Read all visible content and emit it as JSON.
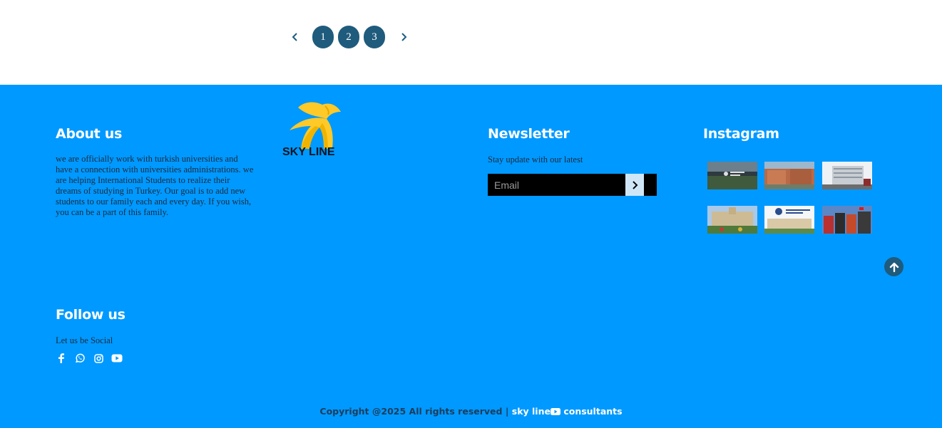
{
  "pagination": {
    "prev_icon": "chevron-left-icon",
    "next_icon": "chevron-right-icon",
    "pages": [
      "1",
      "2",
      "3"
    ]
  },
  "about": {
    "title": "About us",
    "text": "we are officially work with turkish universities and have a connection with universities administrations. we are helping International Students to realize their dreams of studying in Turkey. Our goal is to add new students to our family each and every day. If you wish, you can be a part of this family."
  },
  "logo": {
    "text": "SKY LINE"
  },
  "newsletter": {
    "title": "Newsletter",
    "subtitle": "Stay update with our latest",
    "placeholder": "Email",
    "submit_icon": "chevron-right-icon"
  },
  "instagram": {
    "title": "Instagram",
    "thumbs": [
      "campus-photo-1",
      "campus-photo-2",
      "campus-photo-3",
      "campus-photo-4",
      "campus-photo-5",
      "campus-photo-6"
    ]
  },
  "follow": {
    "title": "Follow us",
    "subtitle": "Let us be Social",
    "icons": [
      "facebook-icon",
      "whatsapp-icon",
      "instagram-icon",
      "youtube-icon"
    ]
  },
  "copyright": {
    "text": "Copyright @2025 All rights reserved | ",
    "brand_a": "sky line",
    "brand_b": " consultants"
  },
  "colors": {
    "footer_bg": "#0099ff",
    "accent": "#1f5b7c",
    "logo_yellow": "#ffc928"
  }
}
